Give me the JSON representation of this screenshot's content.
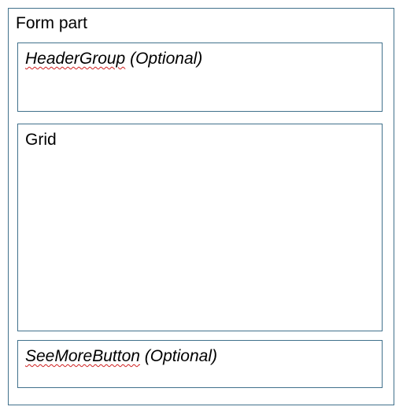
{
  "form_part": {
    "title": "Form part"
  },
  "header_group": {
    "name": "HeaderGroup",
    "qualifier": " (Optional)"
  },
  "grid": {
    "label": "Grid"
  },
  "see_more": {
    "name": "SeeMoreButton",
    "qualifier": " (Optional)"
  },
  "colors": {
    "border": "#41718c",
    "spellcheck_underline": "#d02020"
  }
}
